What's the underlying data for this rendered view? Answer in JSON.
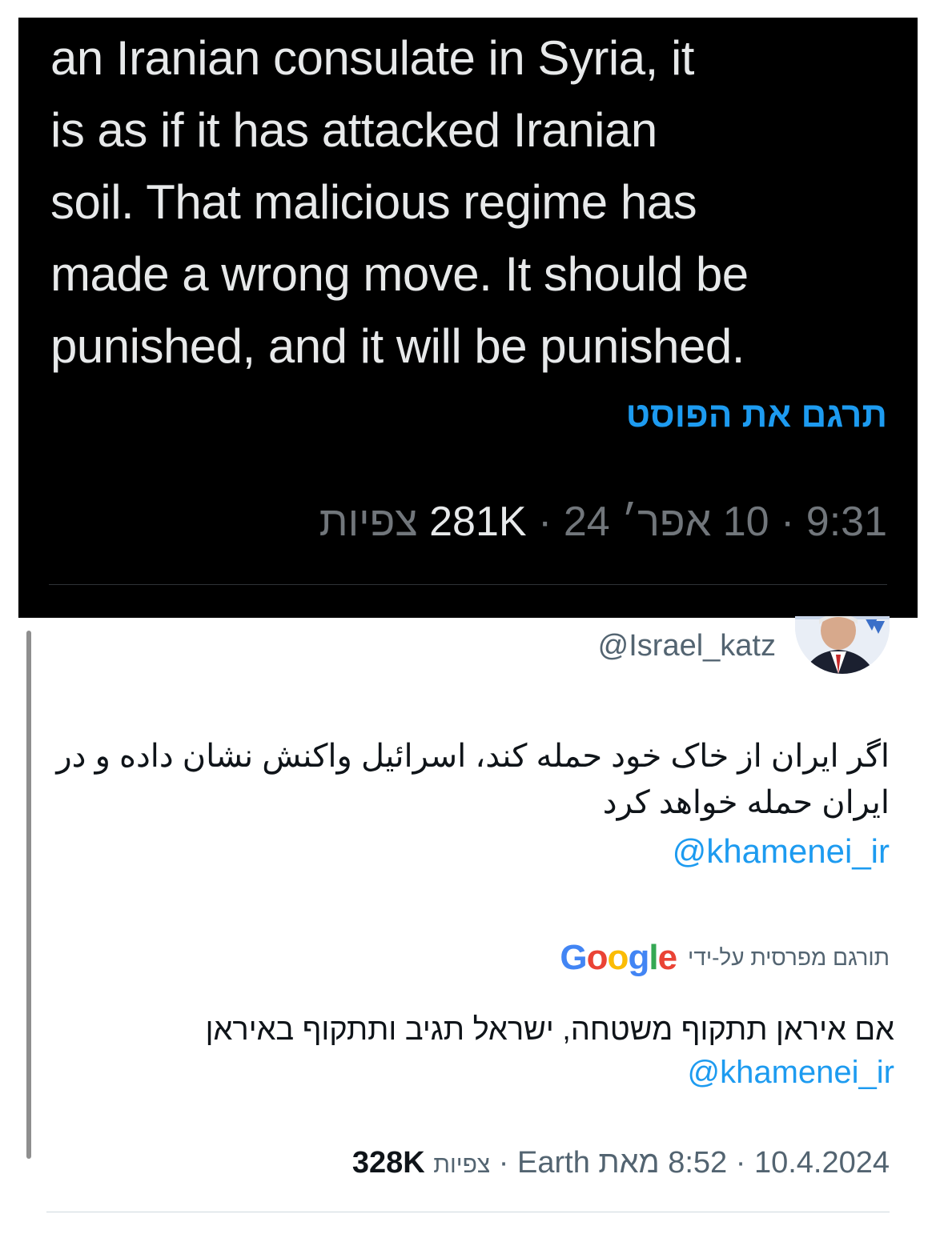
{
  "dark_tweet": {
    "lines": [
      "an Iranian consulate in Syria, it",
      "is as if it has attacked Iranian",
      "soil. That malicious regime has",
      "made a wrong move. It should be",
      "punished, and it will be punished."
    ],
    "translate_label": "תרגם את הפוסט",
    "time": "9:31",
    "date": "10 אפר׳ 24",
    "views_count": "281K",
    "views_label": "צפיות",
    "separator": "·"
  },
  "light_tweet": {
    "handle": "@Israel_katz",
    "avatar_icon": "avatar-photo",
    "persian_text": "اگر ایران از خاک خود حمله کند، اسرائیل واکنش نشان داده و در ایران حمله خواهد کرد",
    "mention": "@khamenei_ir",
    "translated_by_label": "תורגם מפרסית על-ידי",
    "google_letters": [
      "G",
      "o",
      "o",
      "g",
      "l",
      "e"
    ],
    "hebrew_translation": "אם איראן תתקוף משטחה, ישראל תגיב ותתקוף באיראן",
    "mention_2": "@khamenei_ir",
    "date": "10.4.2024",
    "time": "8:52",
    "source": "מאת Earth",
    "views_label": "צפיות",
    "views_count": "328K",
    "separator": "·"
  },
  "colors": {
    "link_blue": "#1d9bf0",
    "dark_bg": "#000000",
    "muted_gray": "#71767b"
  }
}
